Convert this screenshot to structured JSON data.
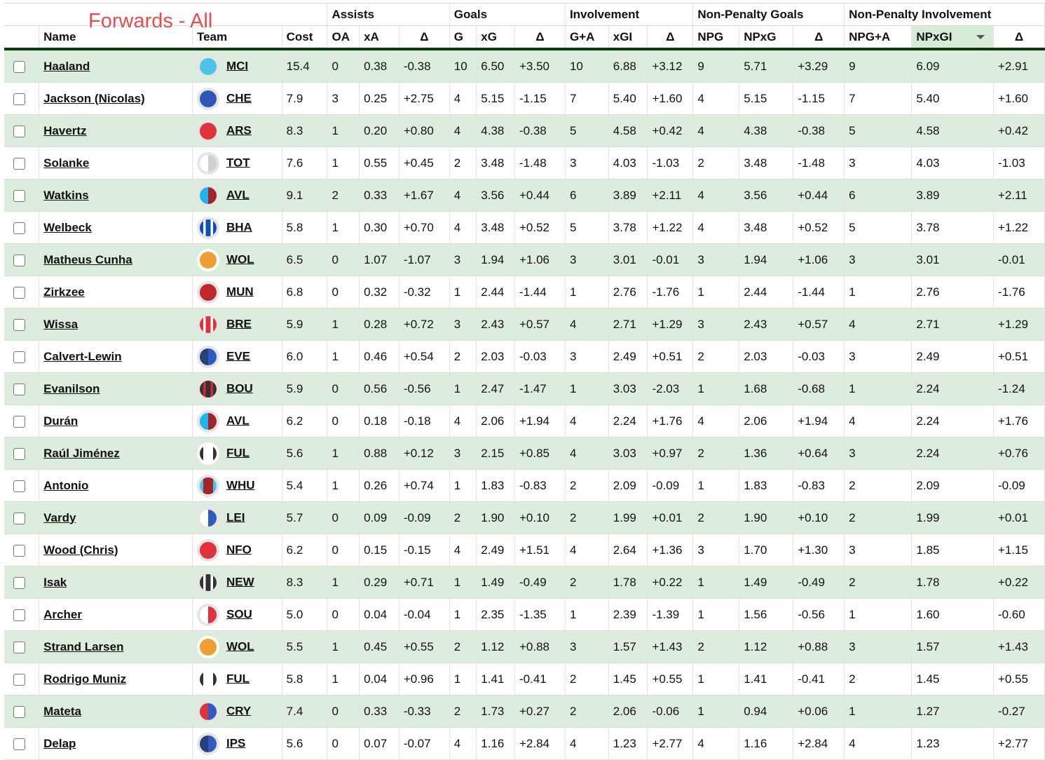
{
  "title_overlay": "Forwards - All",
  "header_groups": [
    {
      "label": "",
      "span": 4
    },
    {
      "label": "Assists",
      "span": 3
    },
    {
      "label": "Goals",
      "span": 3
    },
    {
      "label": "Involvement",
      "span": 3
    },
    {
      "label": "Non-Penalty Goals",
      "span": 3
    },
    {
      "label": "Non-Penalty Involvement",
      "span": 3
    }
  ],
  "columns": [
    "",
    "Name",
    "Team",
    "Cost",
    "OA",
    "xA",
    "Δ",
    "G",
    "xG",
    "Δ",
    "G+A",
    "xGI",
    "Δ",
    "NPG",
    "NPxG",
    "Δ",
    "NPG+A",
    "NPxGI",
    "Δ"
  ],
  "sorted_column": "NPxGI",
  "sort_direction": "descending",
  "team_colors": {
    "MCI": {
      "kit": "solid",
      "colors": [
        "#4dc3e8"
      ],
      "ring": "#e5e5e5"
    },
    "CHE": {
      "kit": "solid",
      "colors": [
        "#2e56b8"
      ],
      "ring": "#e5e5e5"
    },
    "ARS": {
      "kit": "solid",
      "colors": [
        "#e03238"
      ],
      "ring": "#e5e5e5"
    },
    "TOT": {
      "kit": "halves",
      "colors": [
        "#ffffff",
        "#d0d0d0"
      ],
      "ring": "#e5e5e5"
    },
    "AVL": {
      "kit": "halves",
      "colors": [
        "#1ab6ef",
        "#a3232a"
      ],
      "ring": "#e5e5e5"
    },
    "BHA": {
      "kit": "stripes",
      "colors": [
        "#0c4fc1",
        "#ffffff"
      ],
      "ring": "#e5e5e5"
    },
    "WOL": {
      "kit": "solid",
      "colors": [
        "#f0a030"
      ],
      "ring": "#ffffff"
    },
    "MUN": {
      "kit": "solid",
      "colors": [
        "#c0272d"
      ],
      "ring": "#e5e5e5"
    },
    "BRE": {
      "kit": "stripes",
      "colors": [
        "#e03238",
        "#ffffff"
      ],
      "ring": "#e5e5e5"
    },
    "EVE": {
      "kit": "halves",
      "colors": [
        "#25407a",
        "#2f5bc0"
      ],
      "ring": "#e5e5e5"
    },
    "BOU": {
      "kit": "stripes",
      "colors": [
        "#333333",
        "#d8282f"
      ],
      "ring": "#e5e5e5"
    },
    "FUL": {
      "kit": "sides",
      "colors": [
        "#ffffff",
        "#333333"
      ],
      "ring": "#ffffff"
    },
    "WHU": {
      "kit": "center",
      "colors": [
        "#4dc3e8",
        "#a3232a"
      ],
      "ring": "#e5e5e5"
    },
    "LEI": {
      "kit": "halves",
      "colors": [
        "#ffffff",
        "#2f5bc0"
      ],
      "ring": "#e5e5e5"
    },
    "NFO": {
      "kit": "solid",
      "colors": [
        "#e03238"
      ],
      "ring": "#e5e5e5"
    },
    "NEW": {
      "kit": "stripes",
      "colors": [
        "#333333",
        "#ffffff"
      ],
      "ring": "#e5e5e5"
    },
    "SOU": {
      "kit": "halves",
      "colors": [
        "#ffffff",
        "#e03238"
      ],
      "ring": "#e5e5e5"
    },
    "CRY": {
      "kit": "halves",
      "colors": [
        "#e03238",
        "#2f5bc0"
      ],
      "ring": "#e5e5e5"
    },
    "IPS": {
      "kit": "halves",
      "colors": [
        "#25407a",
        "#2f5bc0"
      ],
      "ring": "#e5e5e5"
    }
  },
  "rows": [
    {
      "name": "Haaland",
      "team": "MCI",
      "cost": "15.4",
      "oa": "0",
      "xa": "0.38",
      "a_d": "-0.38",
      "g": "10",
      "xg": "6.50",
      "g_d": "+3.50",
      "ga": "10",
      "xgi": "6.88",
      "gi_d": "+3.12",
      "npg": "9",
      "npxg": "5.71",
      "npg_d": "+3.29",
      "npga": "9",
      "npxgi": "6.09",
      "npgi_d": "+2.91"
    },
    {
      "name": "Jackson (Nicolas)",
      "team": "CHE",
      "cost": "7.9",
      "oa": "3",
      "xa": "0.25",
      "a_d": "+2.75",
      "g": "4",
      "xg": "5.15",
      "g_d": "-1.15",
      "ga": "7",
      "xgi": "5.40",
      "gi_d": "+1.60",
      "npg": "4",
      "npxg": "5.15",
      "npg_d": "-1.15",
      "npga": "7",
      "npxgi": "5.40",
      "npgi_d": "+1.60"
    },
    {
      "name": "Havertz",
      "team": "ARS",
      "cost": "8.3",
      "oa": "1",
      "xa": "0.20",
      "a_d": "+0.80",
      "g": "4",
      "xg": "4.38",
      "g_d": "-0.38",
      "ga": "5",
      "xgi": "4.58",
      "gi_d": "+0.42",
      "npg": "4",
      "npxg": "4.38",
      "npg_d": "-0.38",
      "npga": "5",
      "npxgi": "4.58",
      "npgi_d": "+0.42"
    },
    {
      "name": "Solanke",
      "team": "TOT",
      "cost": "7.6",
      "oa": "1",
      "xa": "0.55",
      "a_d": "+0.45",
      "g": "2",
      "xg": "3.48",
      "g_d": "-1.48",
      "ga": "3",
      "xgi": "4.03",
      "gi_d": "-1.03",
      "npg": "2",
      "npxg": "3.48",
      "npg_d": "-1.48",
      "npga": "3",
      "npxgi": "4.03",
      "npgi_d": "-1.03"
    },
    {
      "name": "Watkins",
      "team": "AVL",
      "cost": "9.1",
      "oa": "2",
      "xa": "0.33",
      "a_d": "+1.67",
      "g": "4",
      "xg": "3.56",
      "g_d": "+0.44",
      "ga": "6",
      "xgi": "3.89",
      "gi_d": "+2.11",
      "npg": "4",
      "npxg": "3.56",
      "npg_d": "+0.44",
      "npga": "6",
      "npxgi": "3.89",
      "npgi_d": "+2.11"
    },
    {
      "name": "Welbeck",
      "team": "BHA",
      "cost": "5.8",
      "oa": "1",
      "xa": "0.30",
      "a_d": "+0.70",
      "g": "4",
      "xg": "3.48",
      "g_d": "+0.52",
      "ga": "5",
      "xgi": "3.78",
      "gi_d": "+1.22",
      "npg": "4",
      "npxg": "3.48",
      "npg_d": "+0.52",
      "npga": "5",
      "npxgi": "3.78",
      "npgi_d": "+1.22"
    },
    {
      "name": "Matheus Cunha",
      "team": "WOL",
      "cost": "6.5",
      "oa": "0",
      "xa": "1.07",
      "a_d": "-1.07",
      "g": "3",
      "xg": "1.94",
      "g_d": "+1.06",
      "ga": "3",
      "xgi": "3.01",
      "gi_d": "-0.01",
      "npg": "3",
      "npxg": "1.94",
      "npg_d": "+1.06",
      "npga": "3",
      "npxgi": "3.01",
      "npgi_d": "-0.01"
    },
    {
      "name": "Zirkzee",
      "team": "MUN",
      "cost": "6.8",
      "oa": "0",
      "xa": "0.32",
      "a_d": "-0.32",
      "g": "1",
      "xg": "2.44",
      "g_d": "-1.44",
      "ga": "1",
      "xgi": "2.76",
      "gi_d": "-1.76",
      "npg": "1",
      "npxg": "2.44",
      "npg_d": "-1.44",
      "npga": "1",
      "npxgi": "2.76",
      "npgi_d": "-1.76"
    },
    {
      "name": "Wissa",
      "team": "BRE",
      "cost": "5.9",
      "oa": "1",
      "xa": "0.28",
      "a_d": "+0.72",
      "g": "3",
      "xg": "2.43",
      "g_d": "+0.57",
      "ga": "4",
      "xgi": "2.71",
      "gi_d": "+1.29",
      "npg": "3",
      "npxg": "2.43",
      "npg_d": "+0.57",
      "npga": "4",
      "npxgi": "2.71",
      "npgi_d": "+1.29"
    },
    {
      "name": "Calvert-Lewin",
      "team": "EVE",
      "cost": "6.0",
      "oa": "1",
      "xa": "0.46",
      "a_d": "+0.54",
      "g": "2",
      "xg": "2.03",
      "g_d": "-0.03",
      "ga": "3",
      "xgi": "2.49",
      "gi_d": "+0.51",
      "npg": "2",
      "npxg": "2.03",
      "npg_d": "-0.03",
      "npga": "3",
      "npxgi": "2.49",
      "npgi_d": "+0.51"
    },
    {
      "name": "Evanilson",
      "team": "BOU",
      "cost": "5.9",
      "oa": "0",
      "xa": "0.56",
      "a_d": "-0.56",
      "g": "1",
      "xg": "2.47",
      "g_d": "-1.47",
      "ga": "1",
      "xgi": "3.03",
      "gi_d": "-2.03",
      "npg": "1",
      "npxg": "1.68",
      "npg_d": "-0.68",
      "npga": "1",
      "npxgi": "2.24",
      "npgi_d": "-1.24"
    },
    {
      "name": "Durán",
      "team": "AVL",
      "cost": "6.2",
      "oa": "0",
      "xa": "0.18",
      "a_d": "-0.18",
      "g": "4",
      "xg": "2.06",
      "g_d": "+1.94",
      "ga": "4",
      "xgi": "2.24",
      "gi_d": "+1.76",
      "npg": "4",
      "npxg": "2.06",
      "npg_d": "+1.94",
      "npga": "4",
      "npxgi": "2.24",
      "npgi_d": "+1.76"
    },
    {
      "name": "Raúl Jiménez",
      "team": "FUL",
      "cost": "5.6",
      "oa": "1",
      "xa": "0.88",
      "a_d": "+0.12",
      "g": "3",
      "xg": "2.15",
      "g_d": "+0.85",
      "ga": "4",
      "xgi": "3.03",
      "gi_d": "+0.97",
      "npg": "2",
      "npxg": "1.36",
      "npg_d": "+0.64",
      "npga": "3",
      "npxgi": "2.24",
      "npgi_d": "+0.76"
    },
    {
      "name": "Antonio",
      "team": "WHU",
      "cost": "5.4",
      "oa": "1",
      "xa": "0.26",
      "a_d": "+0.74",
      "g": "1",
      "xg": "1.83",
      "g_d": "-0.83",
      "ga": "2",
      "xgi": "2.09",
      "gi_d": "-0.09",
      "npg": "1",
      "npxg": "1.83",
      "npg_d": "-0.83",
      "npga": "2",
      "npxgi": "2.09",
      "npgi_d": "-0.09"
    },
    {
      "name": "Vardy",
      "team": "LEI",
      "cost": "5.7",
      "oa": "0",
      "xa": "0.09",
      "a_d": "-0.09",
      "g": "2",
      "xg": "1.90",
      "g_d": "+0.10",
      "ga": "2",
      "xgi": "1.99",
      "gi_d": "+0.01",
      "npg": "2",
      "npxg": "1.90",
      "npg_d": "+0.10",
      "npga": "2",
      "npxgi": "1.99",
      "npgi_d": "+0.01"
    },
    {
      "name": "Wood (Chris)",
      "team": "NFO",
      "cost": "6.2",
      "oa": "0",
      "xa": "0.15",
      "a_d": "-0.15",
      "g": "4",
      "xg": "2.49",
      "g_d": "+1.51",
      "ga": "4",
      "xgi": "2.64",
      "gi_d": "+1.36",
      "npg": "3",
      "npxg": "1.70",
      "npg_d": "+1.30",
      "npga": "3",
      "npxgi": "1.85",
      "npgi_d": "+1.15"
    },
    {
      "name": "Isak",
      "team": "NEW",
      "cost": "8.3",
      "oa": "1",
      "xa": "0.29",
      "a_d": "+0.71",
      "g": "1",
      "xg": "1.49",
      "g_d": "-0.49",
      "ga": "2",
      "xgi": "1.78",
      "gi_d": "+0.22",
      "npg": "1",
      "npxg": "1.49",
      "npg_d": "-0.49",
      "npga": "2",
      "npxgi": "1.78",
      "npgi_d": "+0.22"
    },
    {
      "name": "Archer",
      "team": "SOU",
      "cost": "5.0",
      "oa": "0",
      "xa": "0.04",
      "a_d": "-0.04",
      "g": "1",
      "xg": "2.35",
      "g_d": "-1.35",
      "ga": "1",
      "xgi": "2.39",
      "gi_d": "-1.39",
      "npg": "1",
      "npxg": "1.56",
      "npg_d": "-0.56",
      "npga": "1",
      "npxgi": "1.60",
      "npgi_d": "-0.60"
    },
    {
      "name": "Strand Larsen",
      "team": "WOL",
      "cost": "5.5",
      "oa": "1",
      "xa": "0.45",
      "a_d": "+0.55",
      "g": "2",
      "xg": "1.12",
      "g_d": "+0.88",
      "ga": "3",
      "xgi": "1.57",
      "gi_d": "+1.43",
      "npg": "2",
      "npxg": "1.12",
      "npg_d": "+0.88",
      "npga": "3",
      "npxgi": "1.57",
      "npgi_d": "+1.43"
    },
    {
      "name": "Rodrigo Muniz",
      "team": "FUL",
      "cost": "5.8",
      "oa": "1",
      "xa": "0.04",
      "a_d": "+0.96",
      "g": "1",
      "xg": "1.41",
      "g_d": "-0.41",
      "ga": "2",
      "xgi": "1.45",
      "gi_d": "+0.55",
      "npg": "1",
      "npxg": "1.41",
      "npg_d": "-0.41",
      "npga": "2",
      "npxgi": "1.45",
      "npgi_d": "+0.55"
    },
    {
      "name": "Mateta",
      "team": "CRY",
      "cost": "7.4",
      "oa": "0",
      "xa": "0.33",
      "a_d": "-0.33",
      "g": "2",
      "xg": "1.73",
      "g_d": "+0.27",
      "ga": "2",
      "xgi": "2.06",
      "gi_d": "-0.06",
      "npg": "1",
      "npxg": "0.94",
      "npg_d": "+0.06",
      "npga": "1",
      "npxgi": "1.27",
      "npgi_d": "-0.27"
    },
    {
      "name": "Delap",
      "team": "IPS",
      "cost": "5.6",
      "oa": "0",
      "xa": "0.07",
      "a_d": "-0.07",
      "g": "4",
      "xg": "1.16",
      "g_d": "+2.84",
      "ga": "4",
      "xgi": "1.23",
      "gi_d": "+2.77",
      "npg": "4",
      "npxg": "1.16",
      "npg_d": "+2.84",
      "npga": "4",
      "npxgi": "1.23",
      "npgi_d": "+2.77"
    }
  ]
}
